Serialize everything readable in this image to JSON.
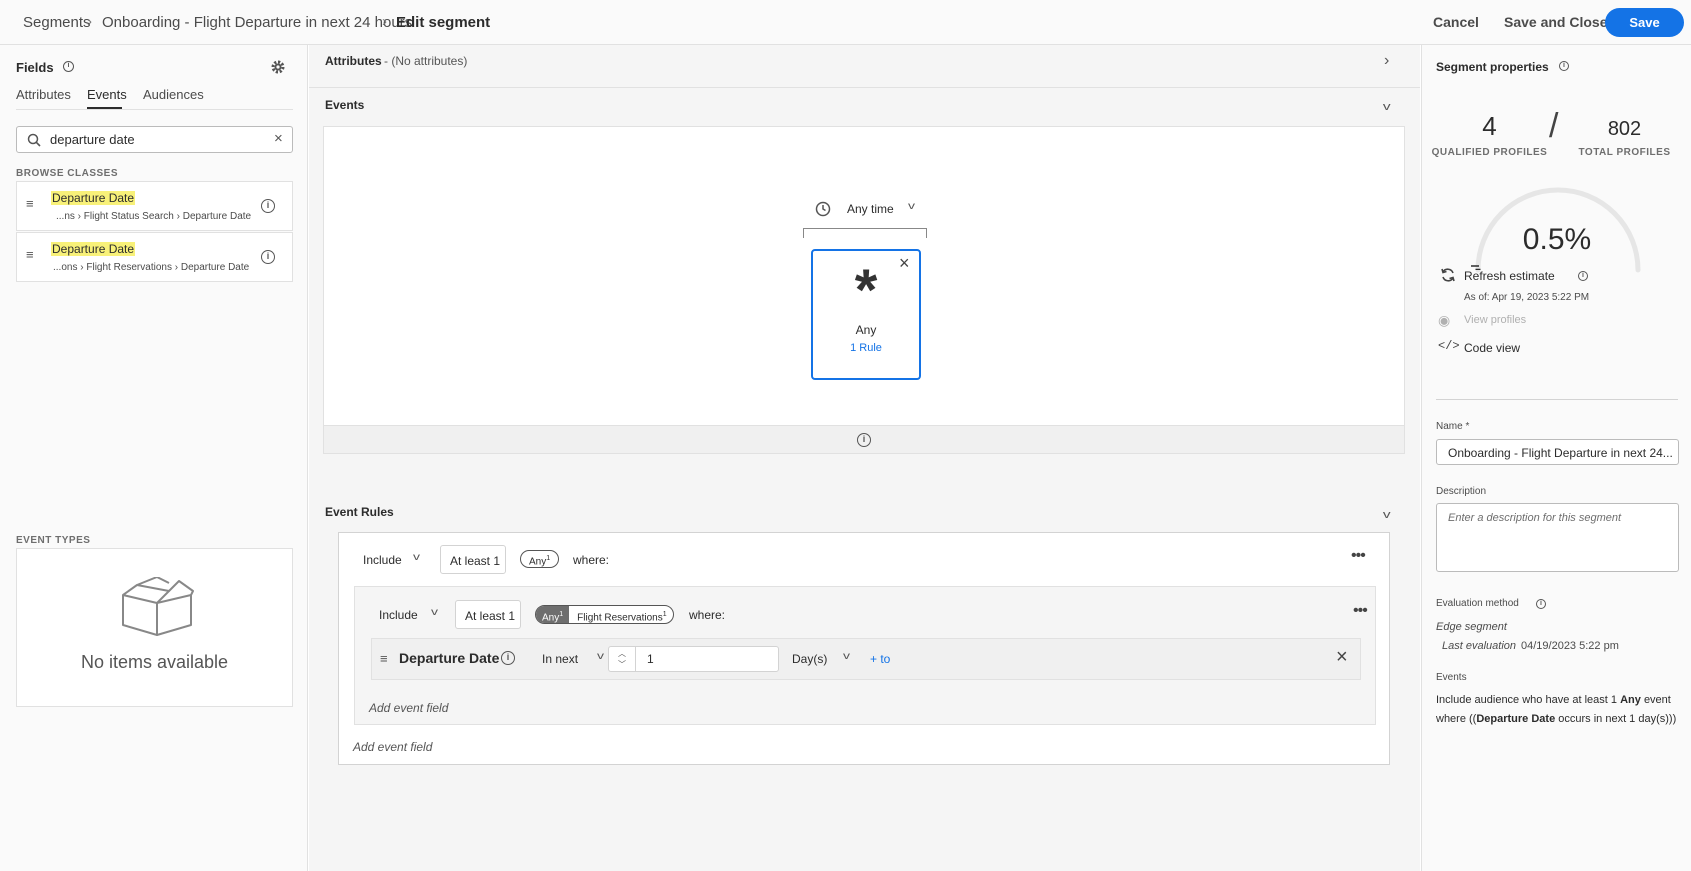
{
  "breadcrumb": {
    "root": "Segments",
    "parent": "Onboarding - Flight Departure in next 24 hours",
    "current": "Edit segment"
  },
  "header": {
    "cancel": "Cancel",
    "save_and_close": "Save and Close",
    "save": "Save"
  },
  "fields_panel": {
    "title": "Fields",
    "tabs": [
      "Attributes",
      "Events",
      "Audiences"
    ],
    "active_tab": "Events",
    "search_value": "departure date",
    "browse_label": "BROWSE CLASSES",
    "results": [
      {
        "name": "Departure Date",
        "path_prefix": "...ns",
        "path_mid": "Flight Status Search",
        "path_end": "Departure Date"
      },
      {
        "name": "Departure Date",
        "path_prefix": "...ons",
        "path_mid": "Flight Reservations",
        "path_end": "Departure Date"
      }
    ],
    "event_types_label": "EVENT TYPES",
    "empty_text": "No items available"
  },
  "canvas": {
    "attributes_title": "Attributes",
    "attributes_note": "- (No attributes)",
    "events_title": "Events",
    "time_filter": "Any time",
    "event_card_title": "Any",
    "event_card_rule": "1 Rule",
    "event_rules_title": "Event Rules",
    "outer_rule": {
      "include": "Include",
      "count": "At least 1",
      "any_label": "Any",
      "any_sup": "1",
      "where": "where:"
    },
    "inner_rule": {
      "include": "Include",
      "count": "At least 1",
      "any_label": "Any",
      "any_sup": "1",
      "event_label": "Flight Reservations",
      "event_sup": "1",
      "where": "where:"
    },
    "condition": {
      "field": "Departure Date",
      "operator": "In next",
      "value": "1",
      "unit": "Day(s)",
      "to_link": "+ to"
    },
    "add_event_field_inner": "Add event field",
    "add_event_field_outer": "Add event field"
  },
  "properties": {
    "title": "Segment properties",
    "qualified": "4",
    "qualified_label": "QUALIFIED PROFILES",
    "total": "802",
    "total_label": "TOTAL PROFILES",
    "percent": "0.5%",
    "percent_fraction": 0.005,
    "refresh": "Refresh estimate",
    "as_of": "As of: Apr 19, 2023 5:22 PM",
    "view_profiles": "View profiles",
    "code_view": "Code view",
    "name_label": "Name *",
    "name_value": "Onboarding - Flight Departure in next 24...",
    "description_label": "Description",
    "description_placeholder": "Enter a description for this segment",
    "eval_label": "Evaluation method",
    "eval_value": "Edge segment",
    "last_eval_label": "Last evaluation",
    "last_eval_value": "04/19/2023 5:22 pm",
    "events_label": "Events",
    "summary": {
      "p1": "Include audience who have at least 1",
      "b1": "Any",
      "p2": "event where ((",
      "b2": "Departure Date",
      "p3": "occurs in next 1 day(s)))"
    }
  },
  "colors": {
    "accent": "#1473e6",
    "highlight": "#f8f179"
  }
}
